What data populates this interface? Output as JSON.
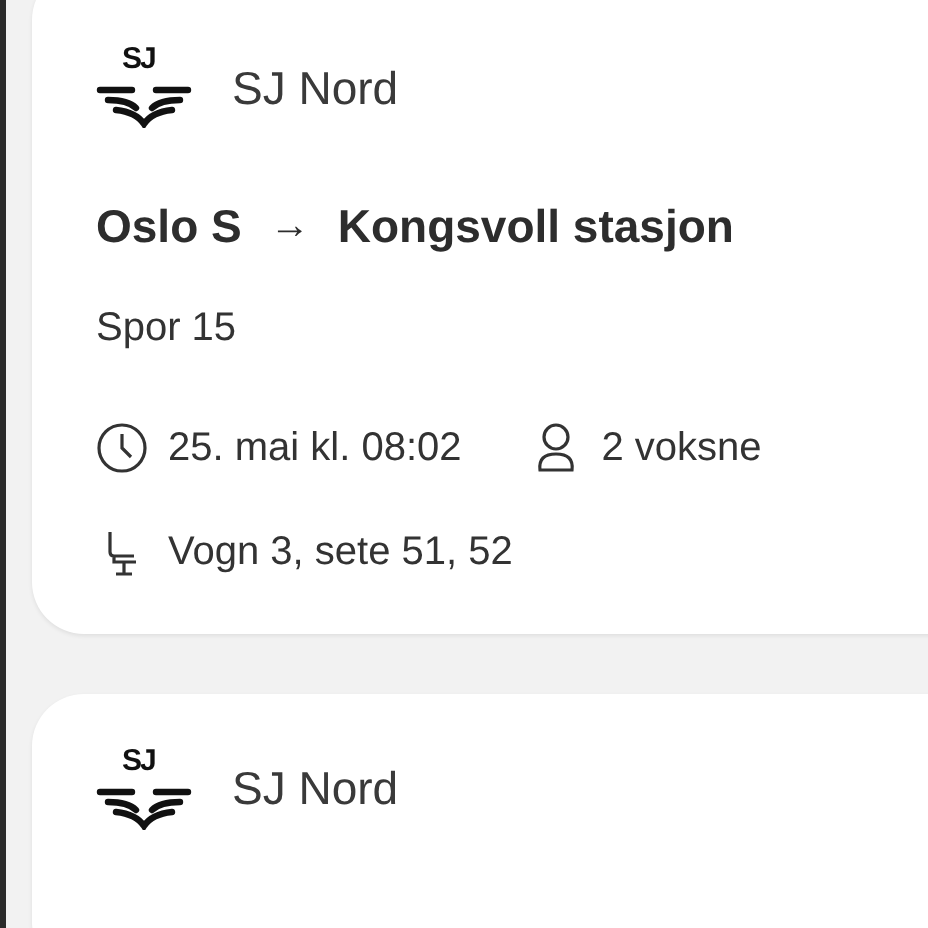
{
  "trips": [
    {
      "operator": {
        "logo_text": "SJ",
        "name": "SJ Nord"
      },
      "from": "Oslo S",
      "arrow": "→",
      "to": "Kongsvoll stasjon",
      "track": "Spor 15",
      "departure": "25. mai kl. 08:02",
      "travellers": "2 voksne",
      "seats": "Vogn 3, sete 51, 52"
    },
    {
      "operator": {
        "logo_text": "SJ",
        "name": "SJ Nord"
      }
    }
  ]
}
